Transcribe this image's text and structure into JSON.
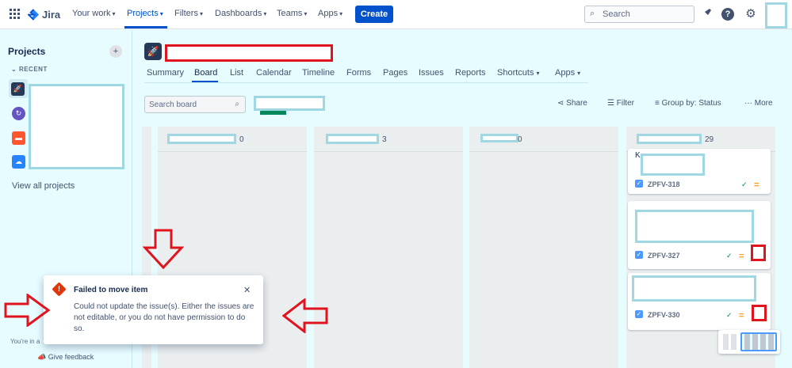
{
  "topnav": {
    "logo_text": "Jira",
    "items": [
      {
        "label": "Your work",
        "chevron": true
      },
      {
        "label": "Projects",
        "chevron": true,
        "active": true
      },
      {
        "label": "Filters",
        "chevron": true
      },
      {
        "label": "Dashboards",
        "chevron": true
      },
      {
        "label": "Teams",
        "chevron": true
      },
      {
        "label": "Apps",
        "chevron": true
      }
    ],
    "create_label": "Create",
    "search_placeholder": "Search",
    "icons": [
      "notifications-icon",
      "help-icon",
      "settings-icon"
    ]
  },
  "sidebar": {
    "title": "Projects",
    "recent_label": "RECENT",
    "view_all_label": "View all projects",
    "footer_text": "You're in a",
    "feedback_label": "Give feedback",
    "project_icons": [
      {
        "name": "rocket-project-icon",
        "color": "#253858"
      },
      {
        "name": "sync-project-icon",
        "color": "#6554c0"
      },
      {
        "name": "box-project-icon",
        "color": "#ff5630"
      },
      {
        "name": "cloud-project-icon",
        "color": "#2684ff"
      }
    ]
  },
  "project": {
    "tabs": [
      {
        "label": "Summary"
      },
      {
        "label": "Board",
        "active": true
      },
      {
        "label": "List"
      },
      {
        "label": "Calendar"
      },
      {
        "label": "Timeline"
      },
      {
        "label": "Forms"
      },
      {
        "label": "Pages"
      },
      {
        "label": "Issues"
      },
      {
        "label": "Reports"
      },
      {
        "label": "Shortcuts",
        "chevron": true
      },
      {
        "label": "Apps",
        "chevron": true
      }
    ]
  },
  "board": {
    "search_placeholder": "Search board",
    "actions": {
      "share": "Share",
      "filter": "Filter",
      "group_by": "Group by: Status",
      "more": "More"
    },
    "columns": [
      {
        "count": "0"
      },
      {
        "count": "3"
      },
      {
        "count": "0"
      },
      {
        "count": "29"
      }
    ],
    "cards": [
      {
        "key": "ZPFV-318",
        "partial_text": "K"
      },
      {
        "key": "ZPFV-327"
      },
      {
        "key": "ZPFV-330"
      }
    ]
  },
  "toast": {
    "title": "Failed to move item",
    "message": "Could not update the issue(s). Either the issues are not editable, or you do not have permission to do so.",
    "close_glyph": "✕"
  },
  "colors": {
    "brand": "#0052cc",
    "background": "#e6fcff",
    "error": "#de350b",
    "annotation_red": "#e0141e",
    "redaction_border": "#9fd7e2"
  }
}
